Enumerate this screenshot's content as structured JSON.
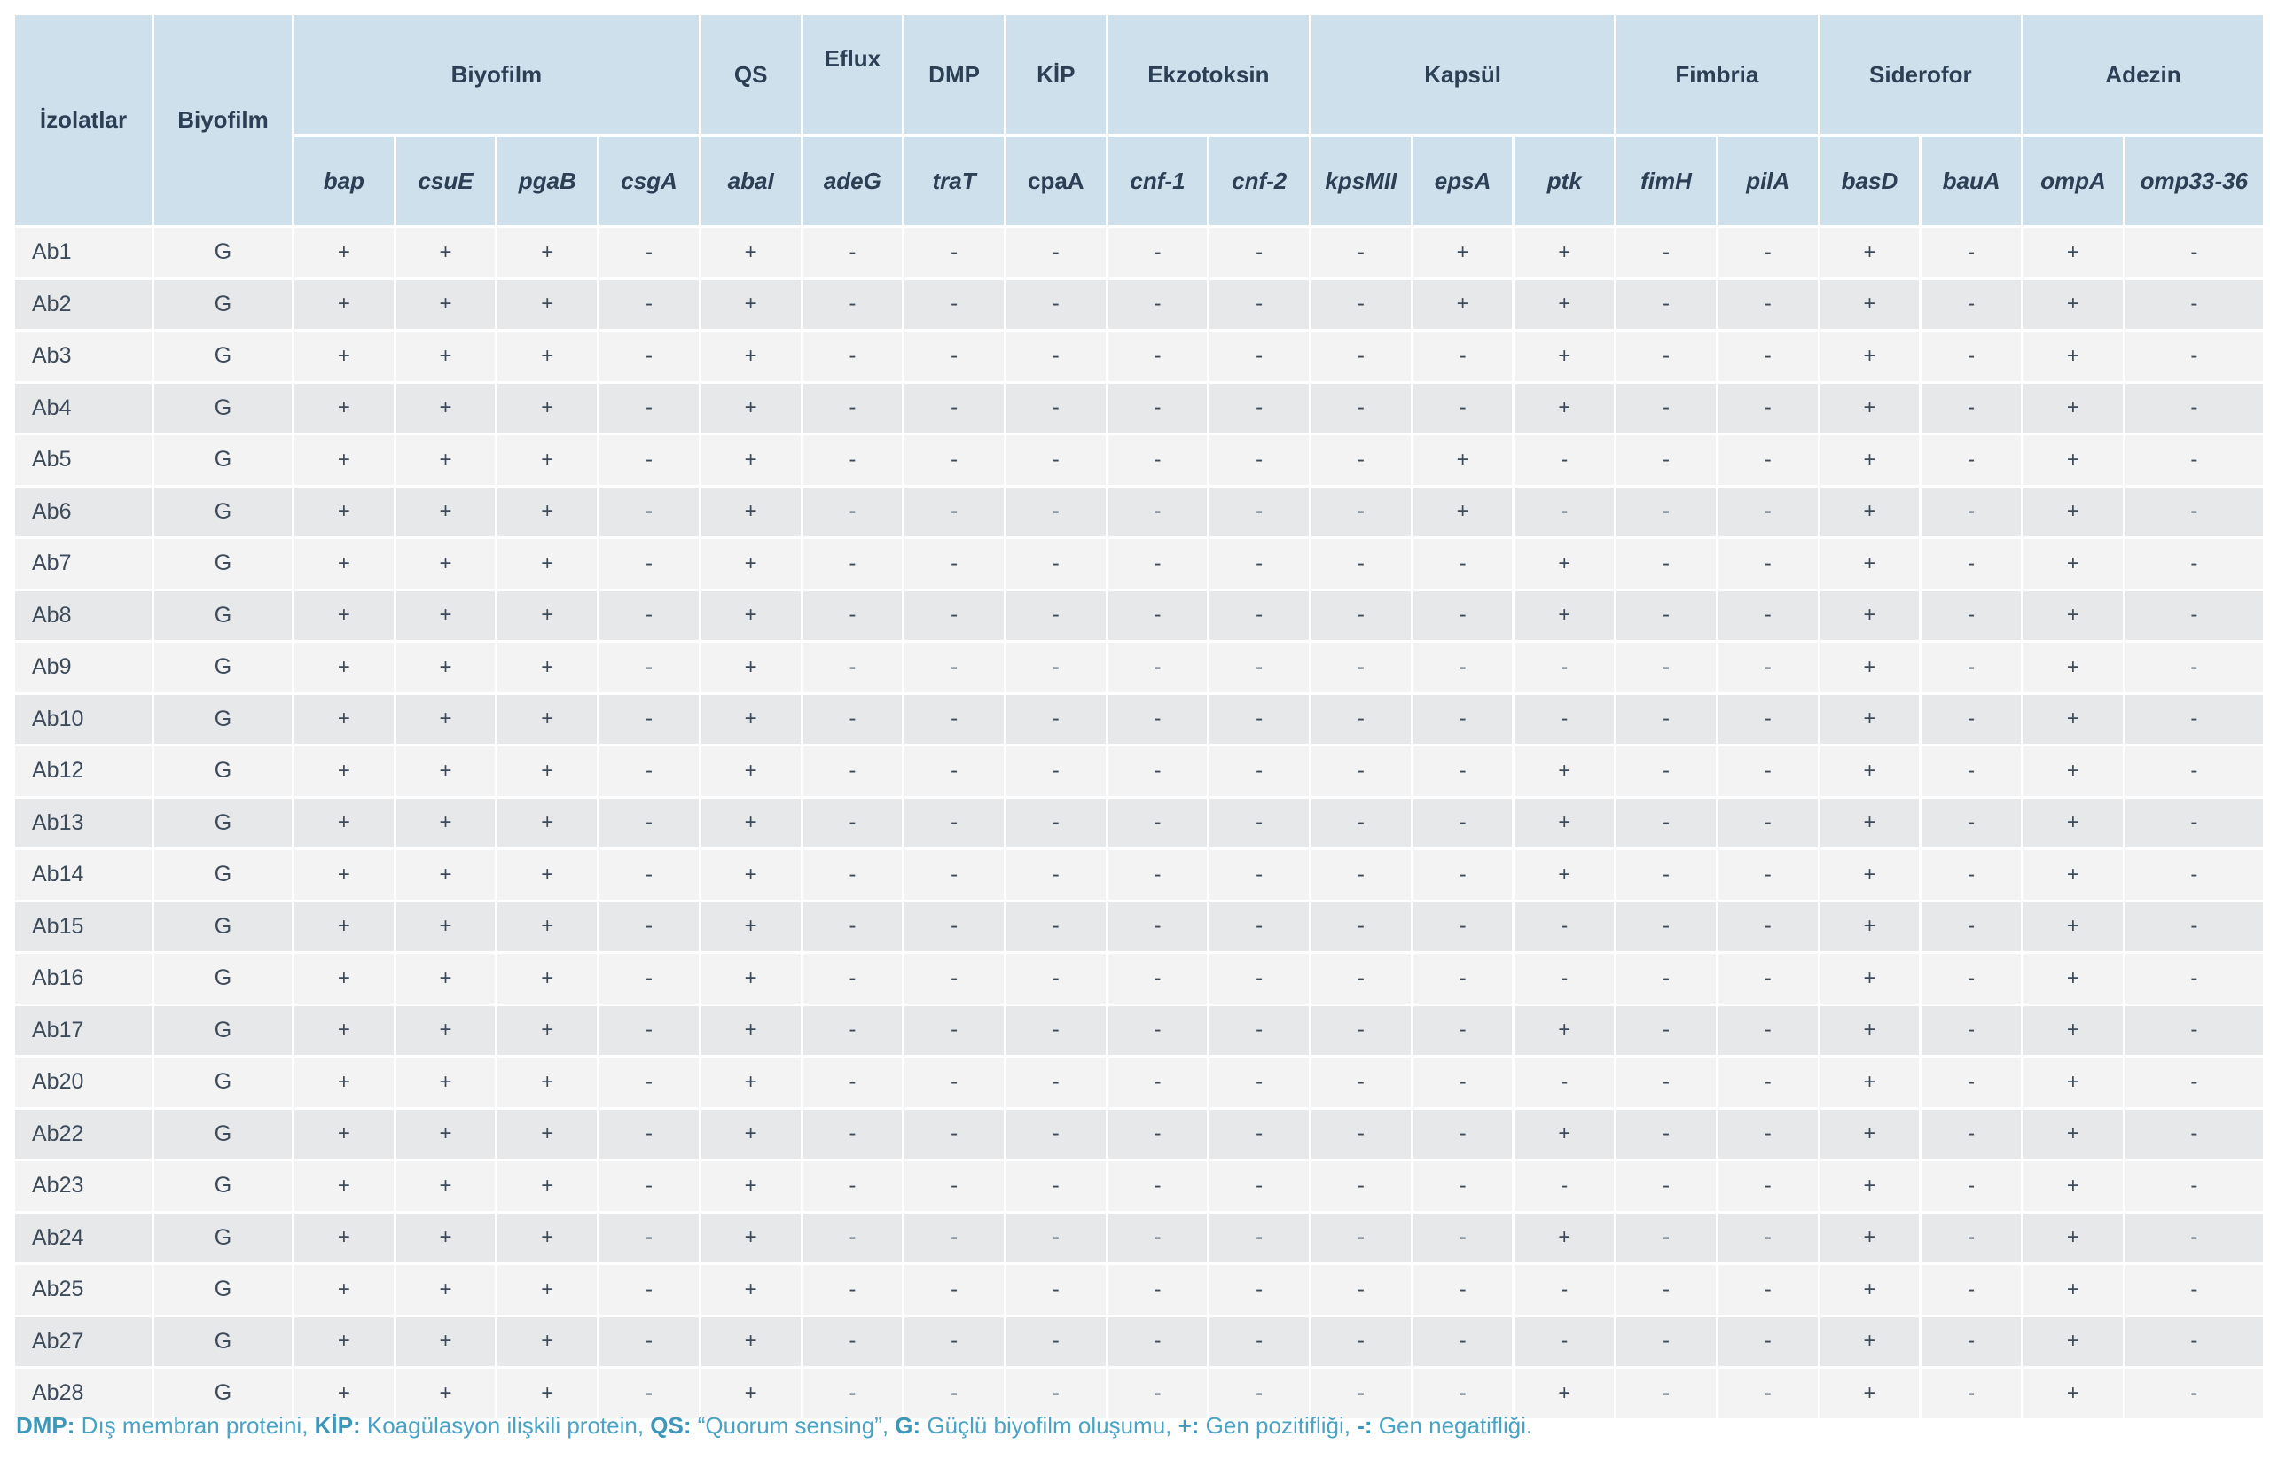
{
  "header": {
    "isolates": "İzolatlar",
    "biofilm": "Biyofilm",
    "groups": [
      "Biyofilm",
      "QS",
      "Eflux",
      "DMP",
      "KİP",
      "Ekzotoksin",
      "Kapsül",
      "Fimbria",
      "Siderofor",
      "Adezin"
    ],
    "genes": [
      "bap",
      "csuE",
      "pgaB",
      "csgA",
      "abaI",
      "adeG",
      "traT",
      "cpaA",
      "cnf-1",
      "cnf-2",
      "kpsMII",
      "epsA",
      "ptk",
      "fimH",
      "pilA",
      "basD",
      "bauA",
      "ompA",
      "omp33-36"
    ]
  },
  "rows": [
    {
      "iso": "Ab1",
      "bio": "G",
      "v": [
        "+",
        "+",
        "+",
        "-",
        "+",
        "-",
        "-",
        "-",
        "-",
        "-",
        "-",
        "+",
        "+",
        "-",
        "-",
        "+",
        "-",
        "+",
        "-"
      ]
    },
    {
      "iso": "Ab2",
      "bio": "G",
      "v": [
        "+",
        "+",
        "+",
        "-",
        "+",
        "-",
        "-",
        "-",
        "-",
        "-",
        "-",
        "+",
        "+",
        "-",
        "-",
        "+",
        "-",
        "+",
        "-"
      ]
    },
    {
      "iso": "Ab3",
      "bio": "G",
      "v": [
        "+",
        "+",
        "+",
        "-",
        "+",
        "-",
        "-",
        "-",
        "-",
        "-",
        "-",
        "-",
        "+",
        "-",
        "-",
        "+",
        "-",
        "+",
        "-"
      ]
    },
    {
      "iso": "Ab4",
      "bio": "G",
      "v": [
        "+",
        "+",
        "+",
        "-",
        "+",
        "-",
        "-",
        "-",
        "-",
        "-",
        "-",
        "-",
        "+",
        "-",
        "-",
        "+",
        "-",
        "+",
        "-"
      ]
    },
    {
      "iso": "Ab5",
      "bio": "G",
      "v": [
        "+",
        "+",
        "+",
        "-",
        "+",
        "-",
        "-",
        "-",
        "-",
        "-",
        "-",
        "+",
        "-",
        "-",
        "-",
        "+",
        "-",
        "+",
        "-"
      ]
    },
    {
      "iso": "Ab6",
      "bio": "G",
      "v": [
        "+",
        "+",
        "+",
        "-",
        "+",
        "-",
        "-",
        "-",
        "-",
        "-",
        "-",
        "+",
        "-",
        "-",
        "-",
        "+",
        "-",
        "+",
        "-"
      ]
    },
    {
      "iso": "Ab7",
      "bio": "G",
      "v": [
        "+",
        "+",
        "+",
        "-",
        "+",
        "-",
        "-",
        "-",
        "-",
        "-",
        "-",
        "-",
        "+",
        "-",
        "-",
        "+",
        "-",
        "+",
        "-"
      ]
    },
    {
      "iso": "Ab8",
      "bio": "G",
      "v": [
        "+",
        "+",
        "+",
        "-",
        "+",
        "-",
        "-",
        "-",
        "-",
        "-",
        "-",
        "-",
        "+",
        "-",
        "-",
        "+",
        "-",
        "+",
        "-"
      ]
    },
    {
      "iso": "Ab9",
      "bio": "G",
      "v": [
        "+",
        "+",
        "+",
        "-",
        "+",
        "-",
        "-",
        "-",
        "-",
        "-",
        "-",
        "-",
        "-",
        "-",
        "-",
        "+",
        "-",
        "+",
        "-"
      ]
    },
    {
      "iso": "Ab10",
      "bio": "G",
      "v": [
        "+",
        "+",
        "+",
        "-",
        "+",
        "-",
        "-",
        "-",
        "-",
        "-",
        "-",
        "-",
        "-",
        "-",
        "-",
        "+",
        "-",
        "+",
        "-"
      ]
    },
    {
      "iso": "Ab12",
      "bio": "G",
      "v": [
        "+",
        "+",
        "+",
        "-",
        "+",
        "-",
        "-",
        "-",
        "-",
        "-",
        "-",
        "-",
        "+",
        "-",
        "-",
        "+",
        "-",
        "+",
        "-"
      ]
    },
    {
      "iso": "Ab13",
      "bio": "G",
      "v": [
        "+",
        "+",
        "+",
        "-",
        "+",
        "-",
        "-",
        "-",
        "-",
        "-",
        "-",
        "-",
        "+",
        "-",
        "-",
        "+",
        "-",
        "+",
        "-"
      ]
    },
    {
      "iso": "Ab14",
      "bio": "G",
      "v": [
        "+",
        "+",
        "+",
        "-",
        "+",
        "-",
        "-",
        "-",
        "-",
        "-",
        "-",
        "-",
        "+",
        "-",
        "-",
        "+",
        "-",
        "+",
        "-"
      ]
    },
    {
      "iso": "Ab15",
      "bio": "G",
      "v": [
        "+",
        "+",
        "+",
        "-",
        "+",
        "-",
        "-",
        "-",
        "-",
        "-",
        "-",
        "-",
        "-",
        "-",
        "-",
        "+",
        "-",
        "+",
        "-"
      ]
    },
    {
      "iso": "Ab16",
      "bio": "G",
      "v": [
        "+",
        "+",
        "+",
        "-",
        "+",
        "-",
        "-",
        "-",
        "-",
        "-",
        "-",
        "-",
        "-",
        "-",
        "-",
        "+",
        "-",
        "+",
        "-"
      ]
    },
    {
      "iso": "Ab17",
      "bio": "G",
      "v": [
        "+",
        "+",
        "+",
        "-",
        "+",
        "-",
        "-",
        "-",
        "-",
        "-",
        "-",
        "-",
        "+",
        "-",
        "-",
        "+",
        "-",
        "+",
        "-"
      ]
    },
    {
      "iso": "Ab20",
      "bio": "G",
      "v": [
        "+",
        "+",
        "+",
        "-",
        "+",
        "-",
        "-",
        "-",
        "-",
        "-",
        "-",
        "-",
        "-",
        "-",
        "-",
        "+",
        "-",
        "+",
        "-"
      ]
    },
    {
      "iso": "Ab22",
      "bio": "G",
      "v": [
        "+",
        "+",
        "+",
        "-",
        "+",
        "-",
        "-",
        "-",
        "-",
        "-",
        "-",
        "-",
        "+",
        "-",
        "-",
        "+",
        "-",
        "+",
        "-"
      ]
    },
    {
      "iso": "Ab23",
      "bio": "G",
      "v": [
        "+",
        "+",
        "+",
        "-",
        "+",
        "-",
        "-",
        "-",
        "-",
        "-",
        "-",
        "-",
        "-",
        "-",
        "-",
        "+",
        "-",
        "+",
        "-"
      ]
    },
    {
      "iso": "Ab24",
      "bio": "G",
      "v": [
        "+",
        "+",
        "+",
        "-",
        "+",
        "-",
        "-",
        "-",
        "-",
        "-",
        "-",
        "-",
        "+",
        "-",
        "-",
        "+",
        "-",
        "+",
        "-"
      ]
    },
    {
      "iso": "Ab25",
      "bio": "G",
      "v": [
        "+",
        "+",
        "+",
        "-",
        "+",
        "-",
        "-",
        "-",
        "-",
        "-",
        "-",
        "-",
        "-",
        "-",
        "-",
        "+",
        "-",
        "+",
        "-"
      ]
    },
    {
      "iso": "Ab27",
      "bio": "G",
      "v": [
        "+",
        "+",
        "+",
        "-",
        "+",
        "-",
        "-",
        "-",
        "-",
        "-",
        "-",
        "-",
        "-",
        "-",
        "-",
        "+",
        "-",
        "+",
        "-"
      ]
    },
    {
      "iso": "Ab28",
      "bio": "G",
      "v": [
        "+",
        "+",
        "+",
        "-",
        "+",
        "-",
        "-",
        "-",
        "-",
        "-",
        "-",
        "-",
        "+",
        "-",
        "-",
        "+",
        "-",
        "+",
        "-"
      ]
    }
  ],
  "footnote": [
    {
      "key": "DMP:",
      "text": " Dış membran proteini, "
    },
    {
      "key": "KİP:",
      "text": " Koagülasyon ilişkili protein, "
    },
    {
      "key": "QS:",
      "text": " “Quorum sensing”, "
    },
    {
      "key": "G:",
      "text": " Güçlü biyofilm oluşumu, "
    },
    {
      "key": "+:",
      "text": " Gen pozitifliği, "
    },
    {
      "key": "-:",
      "text": " Gen negatifliği."
    }
  ]
}
